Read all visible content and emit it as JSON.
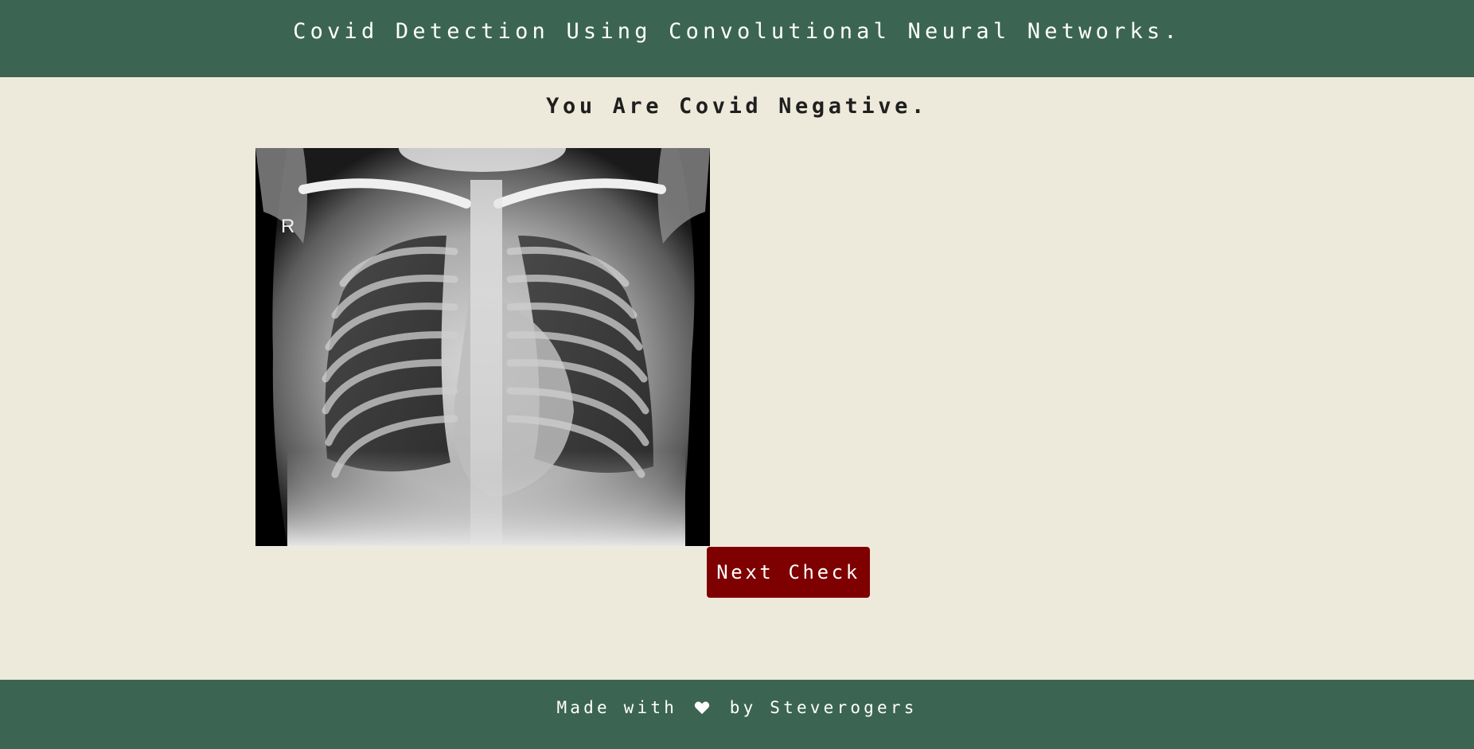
{
  "header": {
    "title": "Covid Detection Using Convolutional Neural Networks."
  },
  "result": {
    "title": "You Are Covid Negative."
  },
  "xray_image": {
    "marker_letter": "R"
  },
  "actions": {
    "next_check_label": "Next Check"
  },
  "footer": {
    "made_with": "Made with",
    "by_author": "by Steverogers",
    "icon": "heart-icon"
  },
  "colors": {
    "header_bg": "#3b6552",
    "page_bg": "#eeeadb",
    "button_bg": "#7f0000",
    "text_light": "#ffffff",
    "text_dark": "#1f1f1f"
  }
}
